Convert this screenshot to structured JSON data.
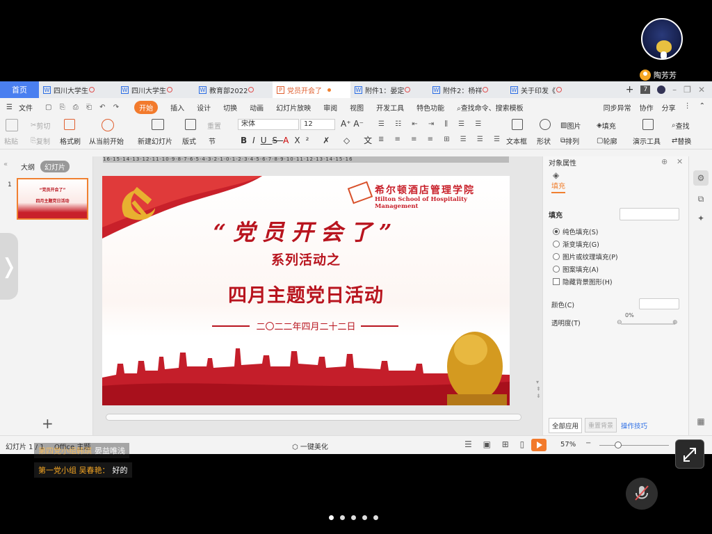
{
  "user": {
    "name": "陶芳芳"
  },
  "tabs": {
    "home": "首页",
    "docs": [
      {
        "label": "四川大学生",
        "type": "doc"
      },
      {
        "label": "四川大学生",
        "type": "doc"
      },
      {
        "label": "教育部2022",
        "type": "doc"
      },
      {
        "label": "党员开会了",
        "type": "ppt",
        "active": true
      },
      {
        "label": "附件1：晏定",
        "type": "doc"
      },
      {
        "label": "附件2：杨祥",
        "type": "doc"
      },
      {
        "label": "关于印发《",
        "type": "doc"
      }
    ],
    "add": "+",
    "count": "7"
  },
  "menu": {
    "file": "文件",
    "items": [
      "开始",
      "插入",
      "设计",
      "切换",
      "动画",
      "幻灯片放映",
      "审阅",
      "视图",
      "开发工具",
      "特色功能"
    ],
    "search": "查找命令、搜索模板",
    "sync": "同步异常",
    "collab": "协作",
    "share": "分享"
  },
  "ribbon": {
    "paste": "粘贴",
    "cut": "剪切",
    "copy": "复制",
    "format_painter": "格式刷",
    "play_from_current": "从当前开始",
    "new_slide": "新建幻灯片",
    "layout": "版式",
    "section": "节",
    "reset": "重置",
    "font_name": "宋体",
    "font_size": "12",
    "textbox": "文本框",
    "shape": "形状",
    "picture": "图片",
    "fill": "填充",
    "arrange": "排列",
    "outline": "轮廓",
    "presentation_tools": "演示工具",
    "find": "查找",
    "replace": "替换"
  },
  "left_panel": {
    "tab_outline": "大纲",
    "tab_slides": "幻灯片",
    "slide_number": "1",
    "add": "+"
  },
  "ruler_text": "16·15·14·13·12·11·10·9·8·7·6·5·4·3·2·1·0·1·2·3·4·5·6·7·8·9·10·11·12·13·14·15·16",
  "slide": {
    "logo_cn": "希尔顿酒店管理学院",
    "logo_en": "Hilton School of Hospitality Management",
    "title": "“党员开会了”",
    "subtitle": "系列活动之",
    "heading": "四月主题党日活动",
    "date": "二〇二二年四月二十二日"
  },
  "right_panel": {
    "title": "对象属性",
    "tab_fill": "填充",
    "section_fill": "填充",
    "options": [
      "纯色填充(S)",
      "渐变填充(G)",
      "图片或纹理填充(P)",
      "图案填充(A)"
    ],
    "hide_bg": "隐藏背景图形(H)",
    "color_label": "颜色(C)",
    "transparency_label": "透明度(T)",
    "transparency_value": "0%",
    "apply_all": "全部应用",
    "reset_bg": "重置背景",
    "tips": "操作技巧"
  },
  "status": {
    "slide_info": "幻灯片 1 / 1",
    "theme": "Office 主题",
    "beautify": "一键美化",
    "zoom": "57%"
  },
  "chat": [
    {
      "who": "第四党小组韩琪",
      "text": "晏益唯浅"
    },
    {
      "who": "第一党小组 吴春艳：",
      "text": "好的"
    }
  ],
  "colors": {
    "accent": "#f27a2c",
    "tab_blue": "#4a7ff0",
    "slide_red": "#b8141e"
  }
}
